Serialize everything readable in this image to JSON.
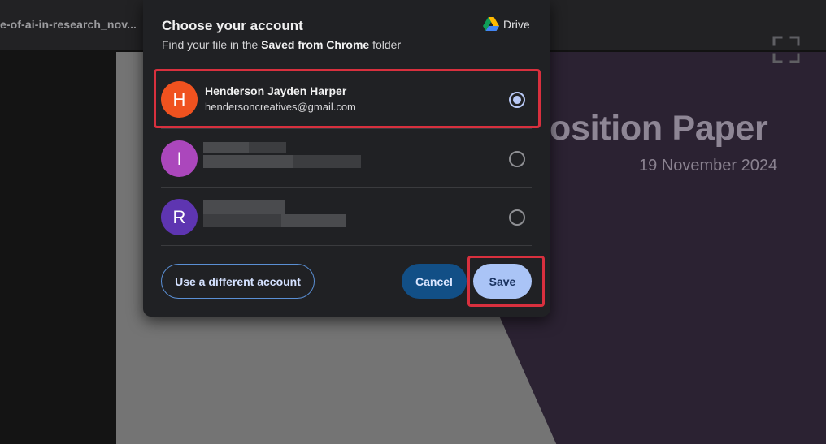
{
  "browser": {
    "tab_title": "e-of-ai-in-research_nov..."
  },
  "slide": {
    "title": "osition Paper",
    "date": "19 November 2024"
  },
  "dialog": {
    "title": "Choose your account",
    "subtitle_prefix": "Find your file in the ",
    "subtitle_folder": "Saved from Chrome",
    "subtitle_suffix": " folder",
    "drive_label": "Drive",
    "accounts": [
      {
        "initial": "H",
        "name": "Henderson Jayden Harper",
        "email": "hendersoncreatives@gmail.com",
        "selected": true,
        "avatar_color": "#f0521f"
      },
      {
        "initial": "I",
        "name": "",
        "email": "",
        "selected": false,
        "avatar_color": "#ab47bc"
      },
      {
        "initial": "R",
        "name": "",
        "email": "",
        "selected": false,
        "avatar_color": "#5e35b1"
      }
    ],
    "buttons": {
      "different_account": "Use a different account",
      "cancel": "Cancel",
      "save": "Save"
    }
  },
  "colors": {
    "highlight": "#d8303e",
    "save_button": "#aac4f6",
    "cancel_button": "#124f86"
  }
}
